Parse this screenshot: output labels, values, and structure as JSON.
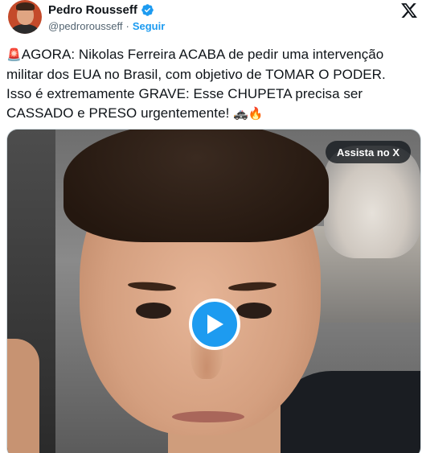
{
  "author": {
    "name": "Pedro Rousseff",
    "handle": "@pedrorousseff",
    "separator": "·",
    "follow_label": "Seguir",
    "verified": true
  },
  "tweet": {
    "emoji_start": "🚨",
    "text_line1": "AGORA: Nikolas Ferreira ACABA de pedir uma intervenção",
    "text_line2": "militar dos EUA no Brasil, com objetivo de TOMAR O PODER.",
    "text_line3": "Isso é extremamente GRAVE: Esse CHUPETA precisa ser",
    "text_line4": "CASSADO e PRESO urgentemente!",
    "emoji_end": "🚓🔥"
  },
  "media": {
    "watch_label": "Assista no X",
    "play_icon": "play-icon"
  },
  "icons": {
    "verified": "verified-badge-icon",
    "platform": "x-logo-icon"
  },
  "colors": {
    "accent": "#1d9bf0",
    "text": "#0f1419",
    "muted": "#536471"
  }
}
